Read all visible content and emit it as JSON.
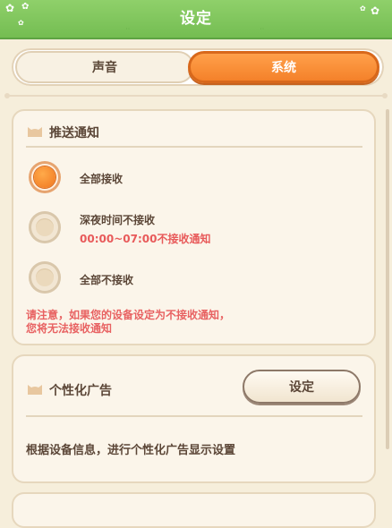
{
  "header": {
    "title": "设定"
  },
  "tabs": {
    "sound_label": "声音",
    "system_label": "系统",
    "active": "system"
  },
  "push": {
    "title": "推送通知",
    "options": [
      {
        "label": "全部接收",
        "sub": "",
        "selected": true
      },
      {
        "label": "深夜时间不接收",
        "sub": "00:00~07:00不接收通知",
        "selected": false
      },
      {
        "label": "全部不接收",
        "sub": "",
        "selected": false
      }
    ],
    "notice_line1": "请注意，如果您的设备设定为不接收通知，",
    "notice_line2": "您将无法接收通知"
  },
  "ads": {
    "title": "个性化广告",
    "button_label": "设定",
    "description": "根据设备信息，进行个性化广告显示设置"
  },
  "colors": {
    "accent": "#f4812a",
    "warning": "#e85a5a",
    "header": "#7cc35a",
    "background": "#f6eedb"
  },
  "icons": [
    "flower-icon",
    "cat-head-icon",
    "radio-selected-icon",
    "radio-unselected-icon"
  ]
}
